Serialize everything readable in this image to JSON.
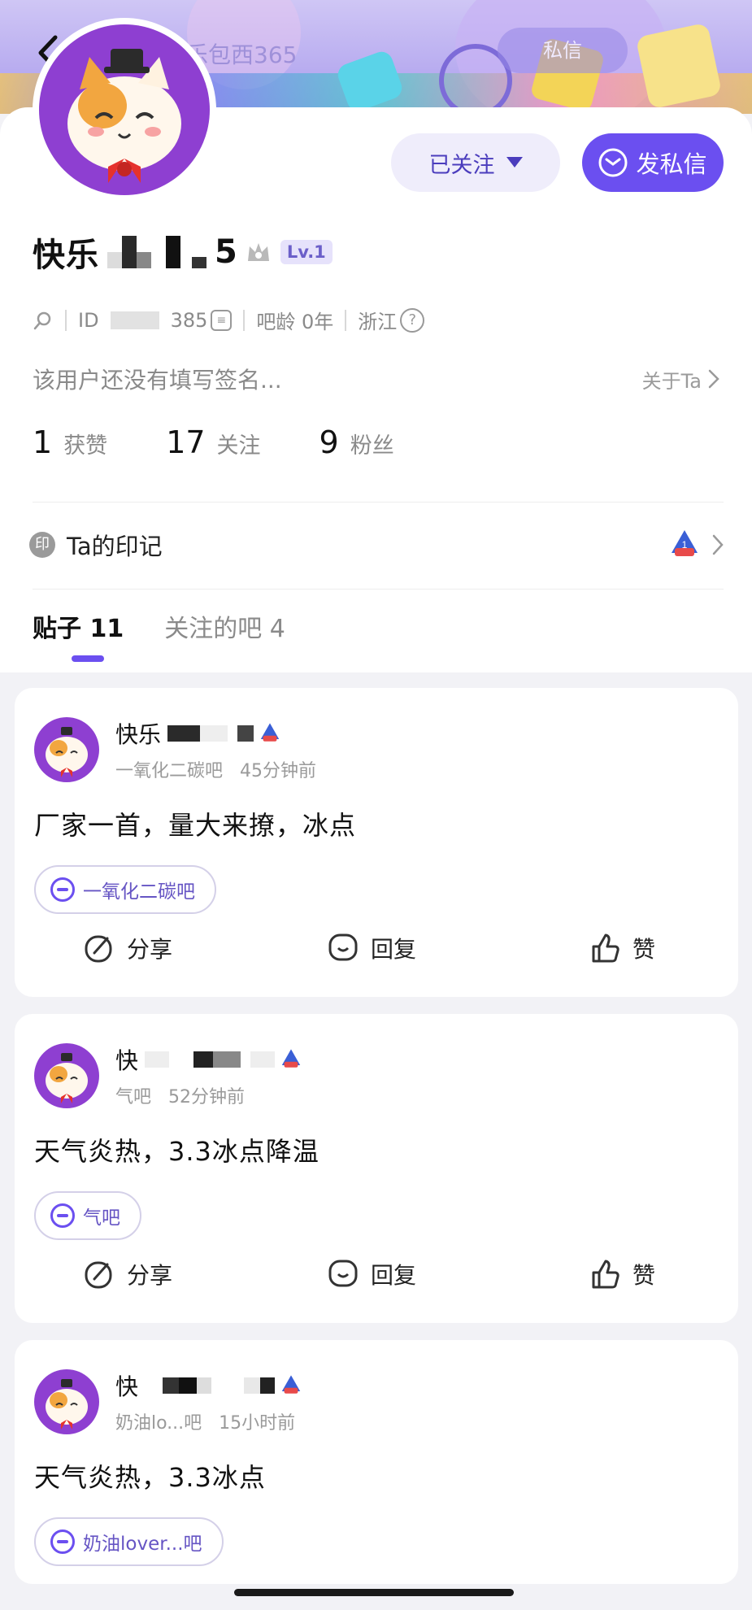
{
  "header": {
    "username": "快乐包西365",
    "message_label": "私信"
  },
  "profile": {
    "name_prefix": "快乐",
    "name_suffix": "5",
    "level": "Lv.1",
    "id_prefix": "ID",
    "id_suffix": "385",
    "bar_age": "吧龄 0年",
    "location": "浙江",
    "signature": "该用户还没有填写签名...",
    "about_label": "关于Ta",
    "stats": [
      {
        "num": "1",
        "label": "获赞"
      },
      {
        "num": "17",
        "label": "关注"
      },
      {
        "num": "9",
        "label": "粉丝"
      }
    ],
    "follow_label": "已关注",
    "dm_label": "发私信",
    "mark_label": "Ta的印记",
    "mark_icon_text": "印"
  },
  "tabs": [
    {
      "label": "贴子 11",
      "active": true
    },
    {
      "label": "关注的吧 4",
      "active": false
    }
  ],
  "posts": [
    {
      "author": "快乐",
      "forum": "一氧化二碳吧",
      "time": "45分钟前",
      "text": "厂家一首，量大来撩，冰点",
      "bar": "一氧化二碳吧"
    },
    {
      "author": "快",
      "forum": "气吧",
      "time": "52分钟前",
      "text": "天气炎热，3.3冰点降温",
      "bar": "气吧"
    },
    {
      "author": "快",
      "forum": "奶油lo...吧",
      "time": "15小时前",
      "text": "天气炎热，3.3冰点",
      "bar": "奶油lover...吧"
    }
  ],
  "actions": {
    "share": "分享",
    "reply": "回复",
    "like": "赞"
  },
  "colors": {
    "accent": "#6b4ff0",
    "avatar_bg": "#8e3fd1",
    "banner": "#b9adf0"
  }
}
